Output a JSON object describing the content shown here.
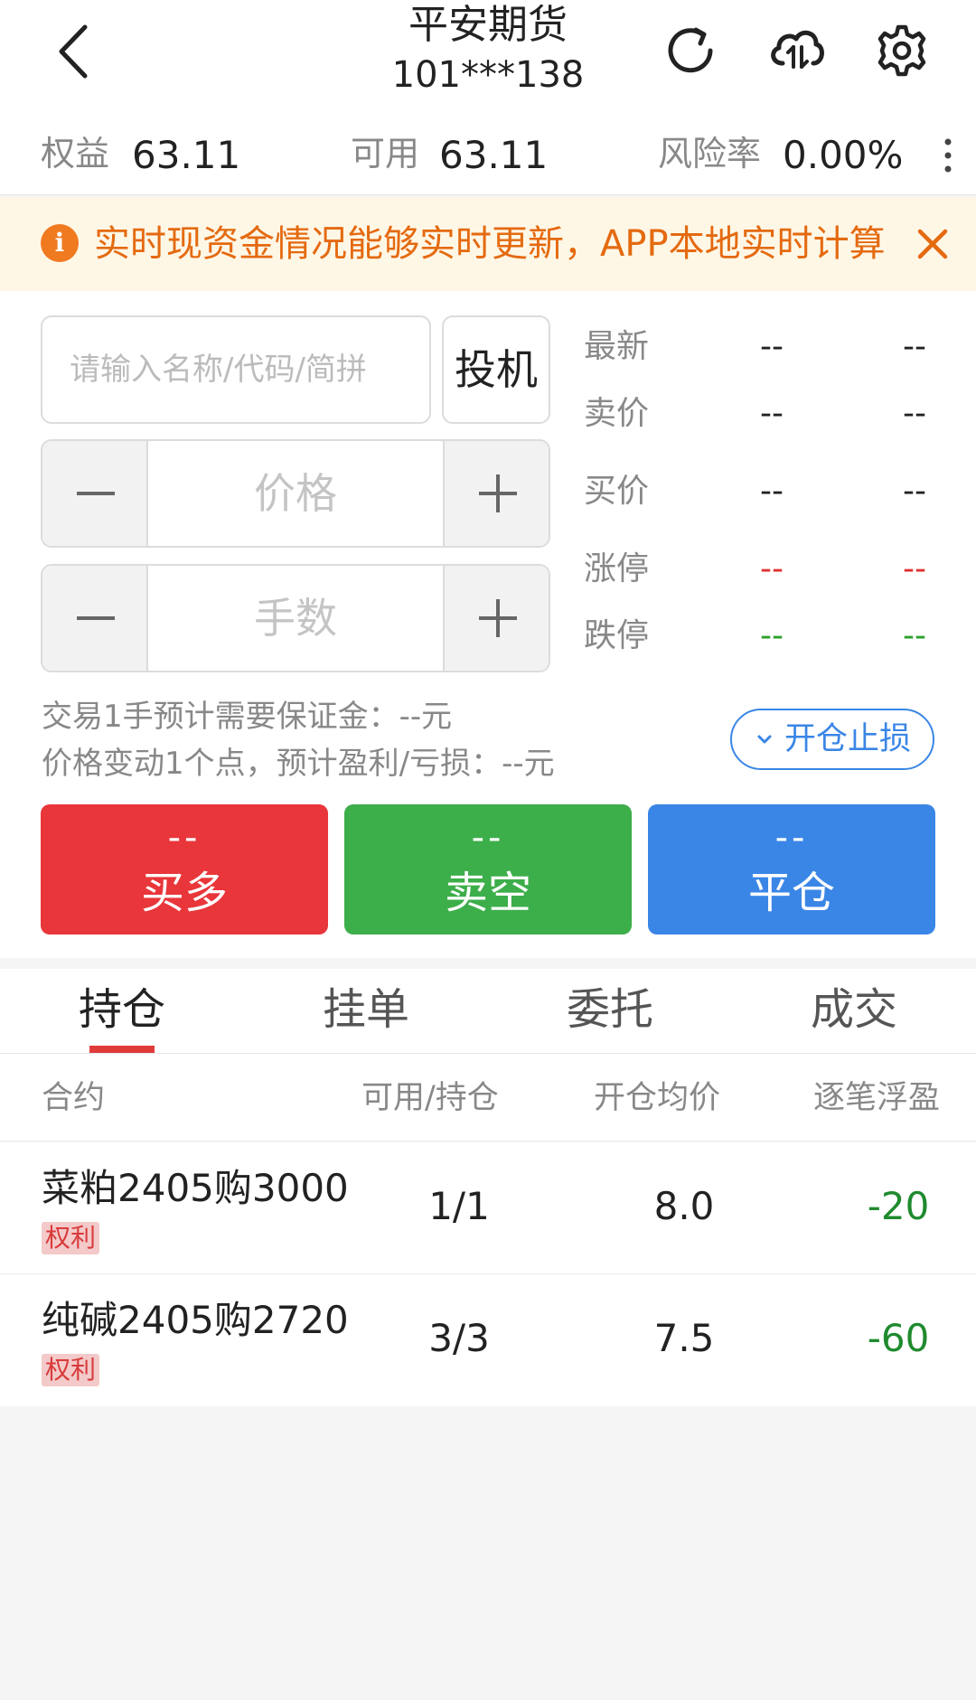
{
  "header": {
    "title": "平安期货",
    "account": "101***138"
  },
  "summary": {
    "equity_label": "权益",
    "equity_value": "63.11",
    "available_label": "可用",
    "available_value": "63.11",
    "risk_label": "风险率",
    "risk_value": "0.00%"
  },
  "notice": {
    "text": "实时现资金情况能够实时更新，APP本地实时计算",
    "icon": "info-icon",
    "color": "#e46a10"
  },
  "form": {
    "search_placeholder": "请输入名称/代码/简拼",
    "speculation_label": "投机",
    "price_placeholder": "价格",
    "lots_placeholder": "手数",
    "margin_text": "交易1手预计需要保证金：--元",
    "profit_text": "价格变动1个点，预计盈利/亏损：--元",
    "stoploss_label": "开仓止损"
  },
  "quotes": [
    {
      "label": "最新",
      "a": "--",
      "b": "--",
      "color": "#222222"
    },
    {
      "label": "卖价",
      "a": "--",
      "b": "--",
      "color": "#222222"
    },
    {
      "label": "买价",
      "a": "--",
      "b": "--",
      "color": "#222222"
    },
    {
      "label": "涨停",
      "a": "--",
      "b": "--",
      "color": "#e03030"
    },
    {
      "label": "跌停",
      "a": "--",
      "b": "--",
      "color": "#2aa02a"
    }
  ],
  "trade_buttons": [
    {
      "price": "--",
      "label": "买多",
      "color": "#e8363a"
    },
    {
      "price": "--",
      "label": "卖空",
      "color": "#3cae4a"
    },
    {
      "price": "--",
      "label": "平仓",
      "color": "#3a86e6"
    }
  ],
  "tabs": [
    "持仓",
    "挂单",
    "委托",
    "成交"
  ],
  "table": {
    "headers": [
      "合约",
      "可用/持仓",
      "开仓均价",
      "逐笔浮盈"
    ],
    "rows": [
      {
        "name": "菜粕2405购3000",
        "tag": "权利",
        "qty": "1/1",
        "avg_price": "8.0",
        "pnl": "-20"
      },
      {
        "name": "纯碱2405购2720",
        "tag": "权利",
        "qty": "3/3",
        "avg_price": "7.5",
        "pnl": "-60"
      }
    ]
  },
  "colors": {
    "accent_red": "#e03b3b",
    "pnl_negative": "#1f8a2e",
    "link_blue": "#3a86e6"
  }
}
